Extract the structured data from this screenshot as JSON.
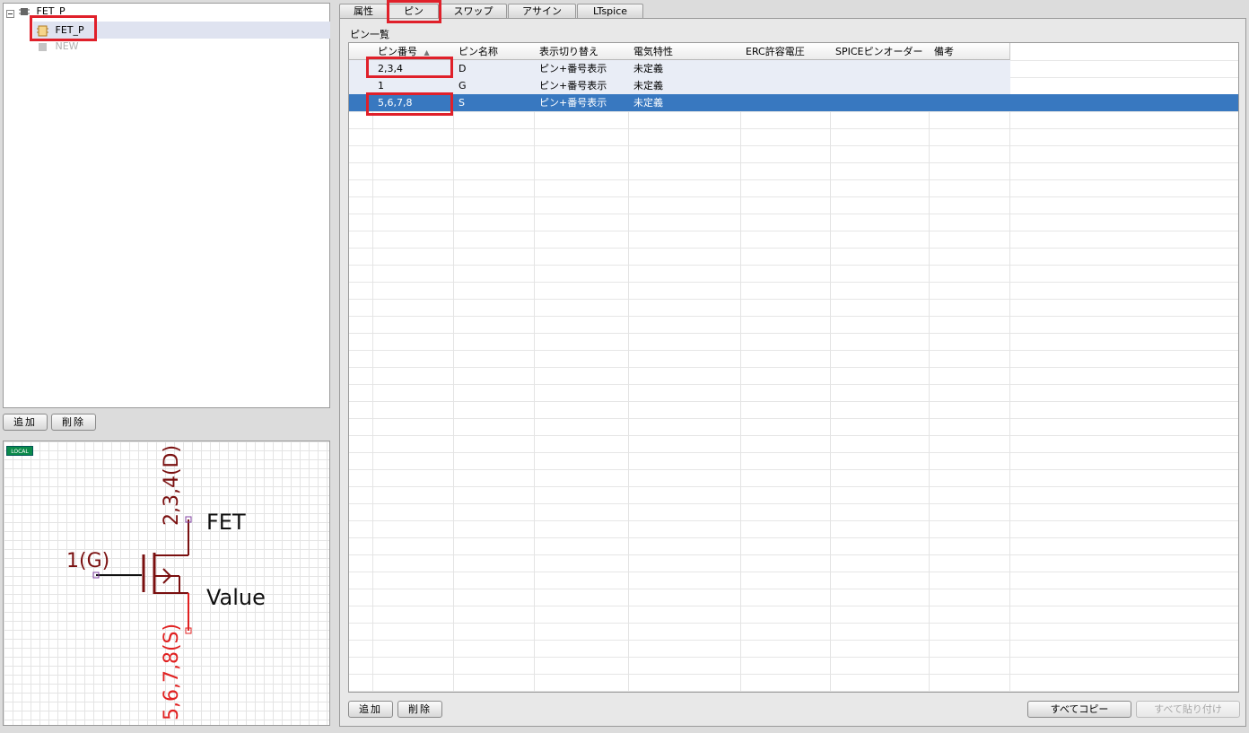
{
  "tree": {
    "root_label": "FET_P",
    "child_label": "FET_P",
    "new_label": "NEW"
  },
  "left_buttons": {
    "add": "追加",
    "delete": "削除"
  },
  "preview": {
    "local_badge": "LOCAL",
    "pin_drain": "2,3,4(D)",
    "pin_gate": "1(G)",
    "pin_source": "5,6,7,8(S)",
    "ref_text": "FET",
    "value_text": "Value"
  },
  "tabs": [
    {
      "label": "属性"
    },
    {
      "label": "ピン",
      "active": true
    },
    {
      "label": "スワップ"
    },
    {
      "label": "アサイン"
    },
    {
      "label": "LTspice"
    }
  ],
  "section_label": "ピン一覧",
  "columns": [
    "ピン番号",
    "ピン名称",
    "表示切り替え",
    "電気特性",
    "ERC許容電圧",
    "SPICEピンオーダー",
    "備考"
  ],
  "rows": [
    {
      "cells": [
        "2,3,4",
        "D",
        "ピン+番号表示",
        "未定義",
        "",
        "",
        ""
      ]
    },
    {
      "cells": [
        "1",
        "G",
        "ピン+番号表示",
        "未定義",
        "",
        "",
        ""
      ]
    },
    {
      "cells": [
        "5,6,7,8",
        "S",
        "ピン+番号表示",
        "未定義",
        "",
        "",
        ""
      ],
      "selected": true
    }
  ],
  "bottom_buttons": {
    "add": "追加",
    "delete": "削除",
    "copy_all": "すべてコピー",
    "paste_all": "すべて貼り付け"
  },
  "colors": {
    "highlight": "#e0202a",
    "selected_row": "#3878c0",
    "symbol_dark": "#7a1010",
    "pin_label_red": "#e02020"
  }
}
